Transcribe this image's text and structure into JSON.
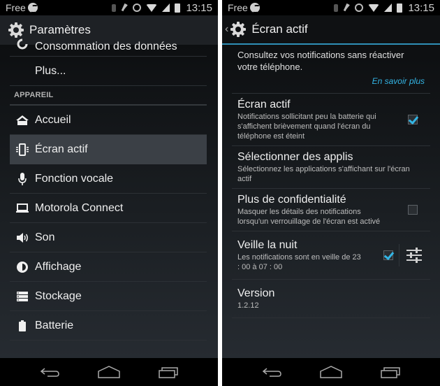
{
  "status_bar": {
    "carrier": "Free",
    "time": "13:15",
    "icons": [
      "carrier-logo-icon",
      "bluetooth-icon",
      "mute-icon",
      "alarm-icon",
      "wifi-icon",
      "signal-icon",
      "battery-icon"
    ]
  },
  "left_screen": {
    "action_bar": {
      "icon": "gear-icon",
      "title": "Paramètres"
    },
    "partial_top_item": {
      "icon": "data-usage-icon",
      "label": "Consommation des données"
    },
    "items_before_section": [
      {
        "label": "Plus..."
      }
    ],
    "section_header": "APPAREIL",
    "items": [
      {
        "icon": "home-icon",
        "label": "Accueil",
        "selected": false
      },
      {
        "icon": "active-display-icon",
        "label": "Écran actif",
        "selected": true
      },
      {
        "icon": "microphone-icon",
        "label": "Fonction vocale",
        "selected": false
      },
      {
        "icon": "laptop-icon",
        "label": "Motorola Connect",
        "selected": false
      },
      {
        "icon": "speaker-icon",
        "label": "Son",
        "selected": false
      },
      {
        "icon": "brightness-icon",
        "label": "Affichage",
        "selected": false
      },
      {
        "icon": "storage-icon",
        "label": "Stockage",
        "selected": false
      },
      {
        "icon": "battery-icon",
        "label": "Batterie",
        "selected": false
      }
    ]
  },
  "right_screen": {
    "action_bar": {
      "icon": "gear-icon",
      "title": "Écran actif"
    },
    "intro": "Consultez vos notifications sans réactiver votre téléphone.",
    "learn_more": "En savoir plus",
    "preferences": [
      {
        "title": "Écran actif",
        "summary": "Notifications sollicitant peu la batterie qui s'affichent brièvement quand l'écran du téléphone est éteint",
        "checkbox": true,
        "checked": true
      },
      {
        "title": "Sélectionner des applis",
        "summary": "Sélectionnez les applications s'affichant sur l'écran actif",
        "checkbox": false
      },
      {
        "title": "Plus de confidentialité",
        "summary": "Masquer les détails des notifications lorsqu'un verrouillage de l'écran est activé",
        "checkbox": true,
        "checked": false
      },
      {
        "title": "Veille la nuit",
        "summary": "Les notifications sont en veille de 23 : 00 à 07 : 00",
        "checkbox": true,
        "checked": true,
        "settings_icon": "sliders-icon"
      },
      {
        "title": "Version",
        "summary": "1.2.12",
        "checkbox": false
      }
    ]
  },
  "nav_bar": {
    "buttons": [
      {
        "icon": "back-icon",
        "label": "Back"
      },
      {
        "icon": "home-icon",
        "label": "Home"
      },
      {
        "icon": "recents-icon",
        "label": "Recent apps"
      }
    ]
  },
  "colors": {
    "accent": "#33b5e5",
    "background": "#15181b",
    "selected_row": "#3b4046",
    "status_bar": "#000000"
  }
}
